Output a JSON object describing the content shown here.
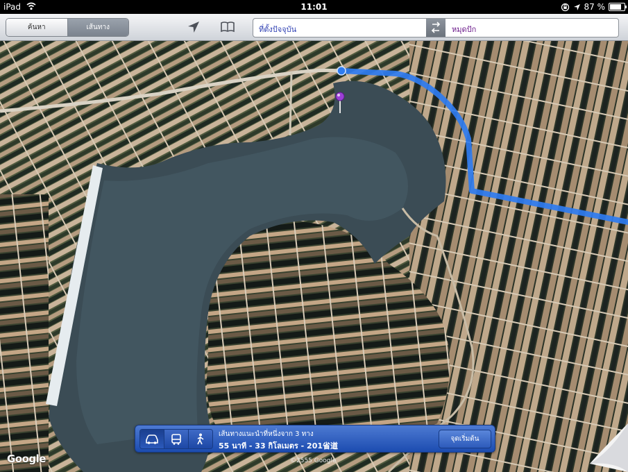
{
  "status_bar": {
    "device": "iPad",
    "time": "11:01",
    "battery_percent": "87 %",
    "battery_level": 0.87,
    "icons": [
      "wifi-icon",
      "orientation-lock-icon",
      "location-arrow-icon",
      "battery-icon"
    ]
  },
  "toolbar": {
    "search_tab": "ค้นหา",
    "directions_tab": "เส้นทาง",
    "selected_tab": "directions",
    "icons": [
      "current-location-icon",
      "bookmarks-icon",
      "swap-icon"
    ]
  },
  "route": {
    "from": "ที่ตั้งปัจจุบัน",
    "to": "หมุดปัก"
  },
  "map": {
    "provider": "Google",
    "copyright": "©2555 Google",
    "route_color": "#2f7cf0",
    "pin_color": "#9b3fd6"
  },
  "directions_panel": {
    "modes": [
      "car-icon",
      "bus-icon",
      "walk-icon"
    ],
    "active_mode": "car-icon",
    "summary": "เส้นทางแนะนำที่หนึ่งจาก 3 ทาง",
    "details": "55 นาที - 33 กิโลเมตร - 201省道",
    "start_button": "จุดเริ่มต้น"
  }
}
